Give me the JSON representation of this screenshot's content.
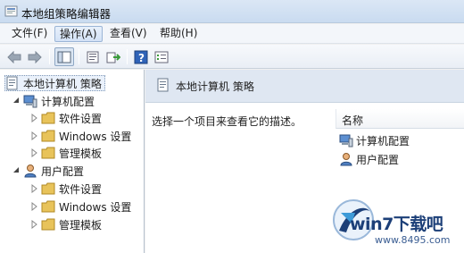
{
  "window": {
    "title": "本地组策略编辑器"
  },
  "menu": {
    "items": [
      "文件(F)",
      "操作(A)",
      "查看(V)",
      "帮助(H)"
    ],
    "active_index": 1
  },
  "toolbar": {
    "icons": [
      "back-arrow-icon",
      "forward-arrow-icon",
      "show-tree-icon",
      "properties-icon",
      "export-icon",
      "help-icon",
      "filter-view-icon"
    ]
  },
  "tree": {
    "root": "本地计算机 策略",
    "computer": {
      "label": "计算机配置",
      "children": [
        "软件设置",
        "Windows 设置",
        "管理模板"
      ]
    },
    "user": {
      "label": "用户配置",
      "children": [
        "软件设置",
        "Windows 设置",
        "管理模板"
      ]
    }
  },
  "detail": {
    "header_title": "本地计算机 策略",
    "description": "选择一个项目来查看它的描述。",
    "column_name": "名称",
    "items": [
      "计算机配置",
      "用户配置"
    ]
  },
  "watermark": {
    "brand": "win7下载吧",
    "url": "www.8495.com"
  },
  "colors": {
    "title_gradient": "#c9dbf0",
    "header_band": "#dfe7f2",
    "selection": "#eaf1fb",
    "folder": "#e8c35a"
  }
}
